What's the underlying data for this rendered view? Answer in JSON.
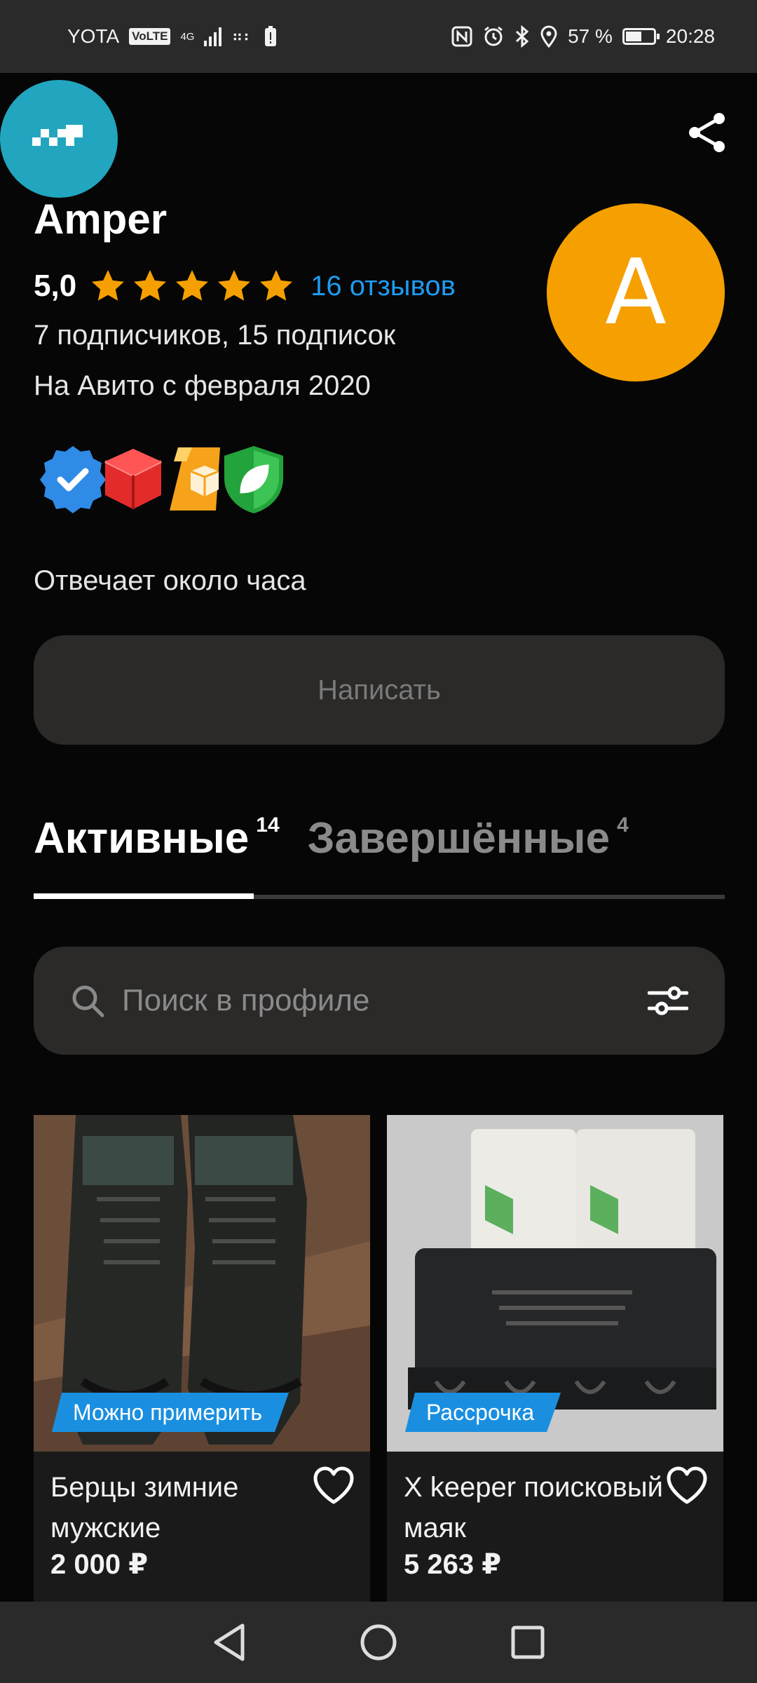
{
  "status_bar": {
    "carrier": "YOTA",
    "volte": "VoLTE",
    "network": "4G",
    "battery_percent": "57 %",
    "time": "20:28"
  },
  "profile": {
    "name": "Amper",
    "rating": "5,0",
    "stars": 5,
    "reviews": "16 отзывов",
    "subscriptions": "7 подписчиков, 15 подписок",
    "since": "На Авито с февраля 2020",
    "avatar_letter": "A",
    "avatar_color": "#f5a000",
    "badge_icons": [
      "verified-check-icon",
      "delivery-box-icon",
      "fast-delivery-icon",
      "eco-leaf-icon"
    ],
    "response_time": "Отвечает около часа",
    "write_button": "Написать"
  },
  "tabs": [
    {
      "label": "Активные",
      "count": "14",
      "active": true
    },
    {
      "label": "Завершённые",
      "count": "4",
      "active": false
    }
  ],
  "search": {
    "placeholder": "Поиск в профиле"
  },
  "listings": [
    {
      "title": "Берцы зимние мужские",
      "price": "2 000 ₽",
      "promo": "Можно примерить"
    },
    {
      "title": "X keeper поисковый маяк",
      "price": "5 263 ₽",
      "promo": "Рассрочка"
    }
  ],
  "colors": {
    "accent_blue": "#1e9bf0",
    "star": "#f5a000",
    "taxi_badge": "#22a6bf"
  }
}
